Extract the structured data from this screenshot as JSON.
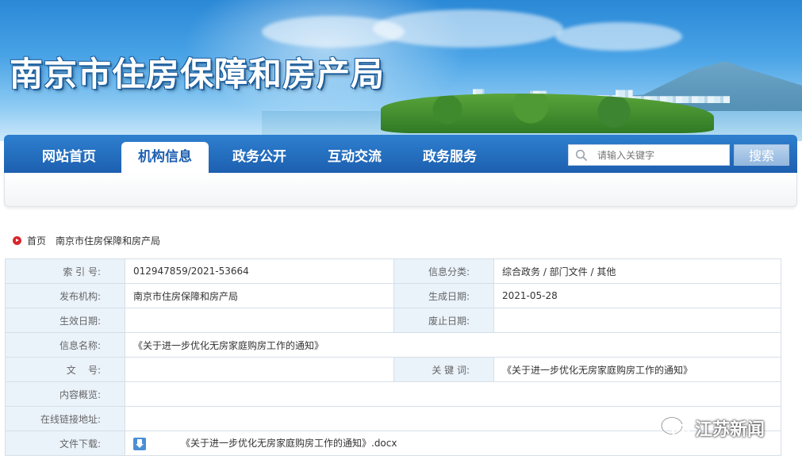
{
  "header": {
    "site_title": "南京市住房保障和房产局"
  },
  "nav": {
    "items": [
      {
        "label": "网站首页",
        "active": false
      },
      {
        "label": "机构信息",
        "active": true
      },
      {
        "label": "政务公开",
        "active": false
      },
      {
        "label": "互动交流",
        "active": false
      },
      {
        "label": "政务服务",
        "active": false
      }
    ],
    "search": {
      "placeholder": "请输入关键字",
      "button_label": "搜索",
      "icon": "search-icon"
    }
  },
  "breadcrumb": {
    "icon": "home-icon",
    "items": [
      "首页",
      "南京市住房保障和房产局"
    ]
  },
  "info": {
    "index_no_label": "索 引 号:",
    "index_no": "012947859/2021-53664",
    "category_label": "信息分类:",
    "category": "综合政务 / 部门文件 / 其他",
    "publisher_label": "发布机构:",
    "publisher": "南京市住房保障和房产局",
    "created_label": "生成日期:",
    "created": "2021-05-28",
    "effective_label": "生效日期:",
    "effective": "",
    "expiry_label": "废止日期:",
    "expiry": "",
    "name_label": "信息名称:",
    "name": "《关于进一步优化无房家庭购房工作的通知》",
    "doc_no_label": "文    号:",
    "doc_no": "",
    "keywords_label": "关 键 词:",
    "keywords": "《关于进一步优化无房家庭购房工作的通知》",
    "summary_label": "内容概览:",
    "summary": "",
    "link_label": "在线链接地址:",
    "link": "",
    "download_label": "文件下载:",
    "download_icon": "download-icon",
    "download_file": "《关于进一步优化无房家庭购房工作的通知》.docx"
  },
  "watermark": {
    "text": "江苏新闻",
    "logo": "wechat-logo"
  }
}
